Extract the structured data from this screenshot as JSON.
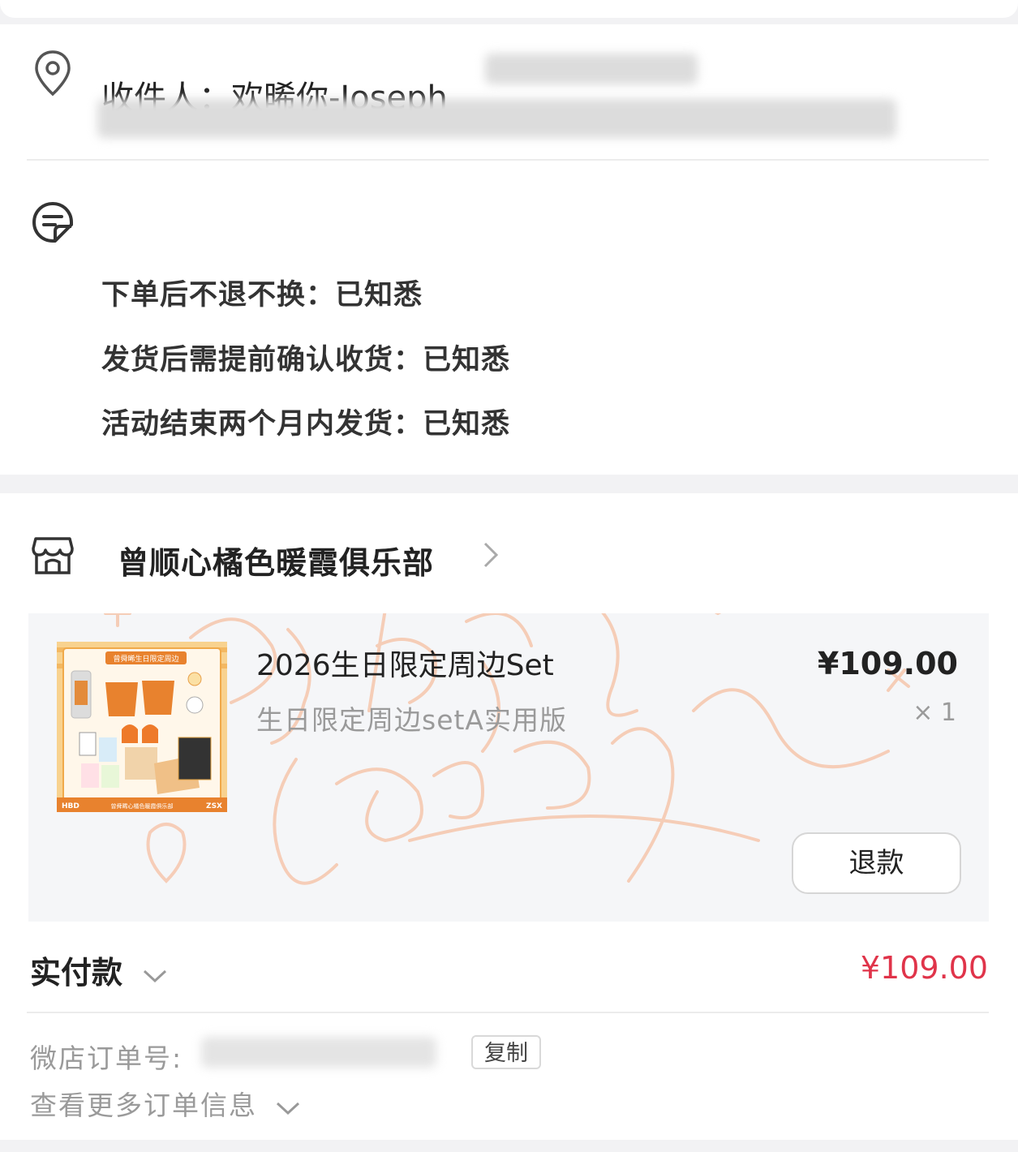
{
  "address": {
    "recipient_label": "收件人：欢晞你-Joseph"
  },
  "notices": [
    "下单后不退不换：已知悉",
    "发货后需提前确认收货：已知悉",
    "活动结束两个月内发货：已知悉"
  ],
  "shop": {
    "name": "曾顺心橘色暖霞俱乐部"
  },
  "product": {
    "title": "2026生日限定周边Set",
    "spec": "生日限定周边setA实用版",
    "price": "¥109.00",
    "quantity": "× 1",
    "refund_label": "退款",
    "thumbnail_text": {
      "banner": "曾舜晞生日限定周边",
      "footer_left": "HBD",
      "footer_center": "曾舜晞心橘色暖霞俱乐部",
      "footer_right": "ZSX"
    }
  },
  "payment": {
    "label": "实付款",
    "amount": "¥109.00"
  },
  "order_meta": {
    "order_no_label": "微店订单号:",
    "copy_label": "复制",
    "more_info_label": "查看更多订单信息"
  },
  "colors": {
    "price_red": "#e0344a",
    "thumbnail_orange": "#f7c87a",
    "watermark": "#f6c9b0"
  },
  "icons": [
    "location-pin-icon",
    "note-icon",
    "store-icon",
    "chevron-right-icon",
    "chevron-down-icon"
  ]
}
